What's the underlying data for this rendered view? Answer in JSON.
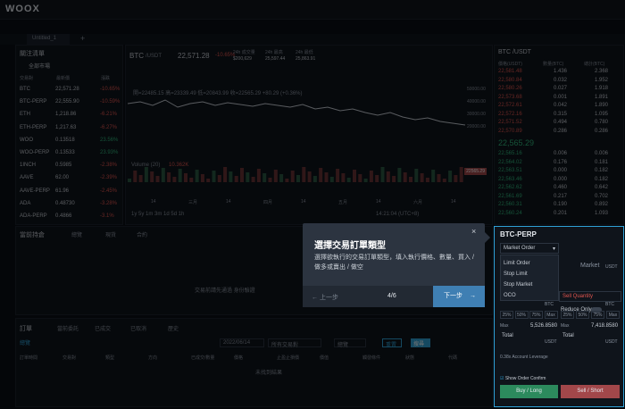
{
  "app": {
    "logo": "WOOX",
    "tab": "Untitled_1",
    "tab_plus": "+"
  },
  "watchlist": {
    "title": "關注清單",
    "filter": "全部市場",
    "cols": [
      "交易對",
      "最新價",
      "漲跌"
    ],
    "rows": [
      {
        "pair": "BTC",
        "price": "22,571.28",
        "chg": "-10.65%"
      },
      {
        "pair": "BTC-PERP",
        "price": "22,555.90",
        "chg": "-10.59%"
      },
      {
        "pair": "ETH",
        "price": "1,218.86",
        "chg": "-6.21%"
      },
      {
        "pair": "ETH-PERP",
        "price": "1,217.63",
        "chg": "-6.27%"
      },
      {
        "pair": "WOO",
        "price": "0.13518",
        "chg": "23.56%"
      },
      {
        "pair": "WOO-PERP",
        "price": "0.13533",
        "chg": "23.93%"
      },
      {
        "pair": "1INCH",
        "price": "0.5985",
        "chg": "-2.38%"
      },
      {
        "pair": "AAVE",
        "price": "62.00",
        "chg": "-2.39%"
      },
      {
        "pair": "AAVE-PERP",
        "price": "61.96",
        "chg": "-2.45%"
      },
      {
        "pair": "ADA",
        "price": "0.48730",
        "chg": "-3.28%"
      },
      {
        "pair": "ADA-PERP",
        "price": "0.4866",
        "chg": "-3.1%"
      }
    ]
  },
  "chart": {
    "symbol": "BTC",
    "quote": "/USDT",
    "price": "22,571.28",
    "change": "-10.65%",
    "vol_label": "24h 成交量",
    "vol_value": "$200,629",
    "high_label": "24h 最高",
    "high_value": "25,597.44",
    "low_label": "24h 最低",
    "low_value": "25,863.91",
    "ohlc": "開=22485.15 高=23339.49 低=20843.99 收=22565.29 +80.29 (+0.36%)",
    "volume_label": "Volume (20)",
    "volume_value": "10.362K",
    "y_ticks": [
      "50000.00",
      "40000.00",
      "30000.00",
      "20000.00"
    ],
    "x_ticks": [
      "14",
      "三月",
      "14",
      "四月",
      "14",
      "五月",
      "14",
      "六月",
      "14"
    ],
    "price_tag": "22565.29",
    "tf": "1y 5y 1m 3m 1d 5d 1h",
    "timestamp": "14:21:04 (UTC+8)"
  },
  "book": {
    "title": "BTC /USDT",
    "cols": [
      "價格(USDT)",
      "數量(BTC)",
      "總計(BTC)"
    ],
    "asks": [
      [
        "22,581.48",
        "1.436",
        "2.368"
      ],
      [
        "22,580.84",
        "0.032",
        "1.952"
      ],
      [
        "22,580.26",
        "0.027",
        "1.918"
      ],
      [
        "22,573.68",
        "0.001",
        "1.891"
      ],
      [
        "22,572.61",
        "0.042",
        "1.890"
      ],
      [
        "22,572.16",
        "0.315",
        "1.095"
      ],
      [
        "22,571.52",
        "0.494",
        "0.780"
      ],
      [
        "22,570.89",
        "0.286",
        "0.286"
      ]
    ],
    "mid": "22,565.29",
    "bids": [
      [
        "22,565.16",
        "0.006",
        "0.006"
      ],
      [
        "22,564.02",
        "0.176",
        "0.181"
      ],
      [
        "22,563.51",
        "0.000",
        "0.182"
      ],
      [
        "22,563.46",
        "0.000",
        "0.182"
      ],
      [
        "22,562.62",
        "0.460",
        "0.642"
      ],
      [
        "22,561.69",
        "0.217",
        "0.702"
      ],
      [
        "22,560.31",
        "0.190",
        "0.892"
      ],
      [
        "22,560.24",
        "0.201",
        "1.093"
      ]
    ]
  },
  "positions": {
    "title": "當前持倉",
    "tabs": [
      "總覽",
      "現貨",
      "合約"
    ],
    "empty": "交易前請先通過 身份驗證"
  },
  "orders": {
    "title": "訂單",
    "tabs": [
      "當前委託",
      "已成交",
      "已取消",
      "歷史"
    ],
    "filter1": "總覽",
    "date_to": "2022/06/14",
    "pairs_label": "所有交易對",
    "all_label": "總覽",
    "reset": "重置",
    "search": "搜尋",
    "cols": [
      "訂單時間",
      "交易對",
      "類型",
      "方向",
      "已成交/數量",
      "價格",
      "止盈止損價",
      "價值",
      "觸發條件",
      "狀態",
      "代碼"
    ],
    "empty": "未找到結果"
  },
  "form": {
    "symbol": "BTC-PERP",
    "order_type": "Market Order",
    "menu": [
      "Limit Order",
      "Stop Limit",
      "Stop Market",
      "OCO"
    ],
    "market_label": "Market",
    "usdt": "USDT",
    "reduce_only": "Reduce Only",
    "sell_qty": "Sell Quantity",
    "btc": "BTC",
    "pcts": [
      "25%",
      "50%",
      "75%",
      "Max"
    ],
    "max_label": "Max",
    "max_buy": "5,526.8580",
    "max_sell": "7,418.8580",
    "total_label": "Total",
    "leverage": "0.38x Account Leverage",
    "show_confirm": "Show Order Confirm",
    "buy": "Buy / Long",
    "sell": "Sell / Short"
  },
  "tour": {
    "title": "選擇交易訂單類型",
    "text": "選擇欲執行的交易訂單類型，填入執行價格、數量、買入 / 做多或賣出 / 做空",
    "prev": "上一步",
    "step": "4/6",
    "next": "下一步",
    "close": "×"
  }
}
